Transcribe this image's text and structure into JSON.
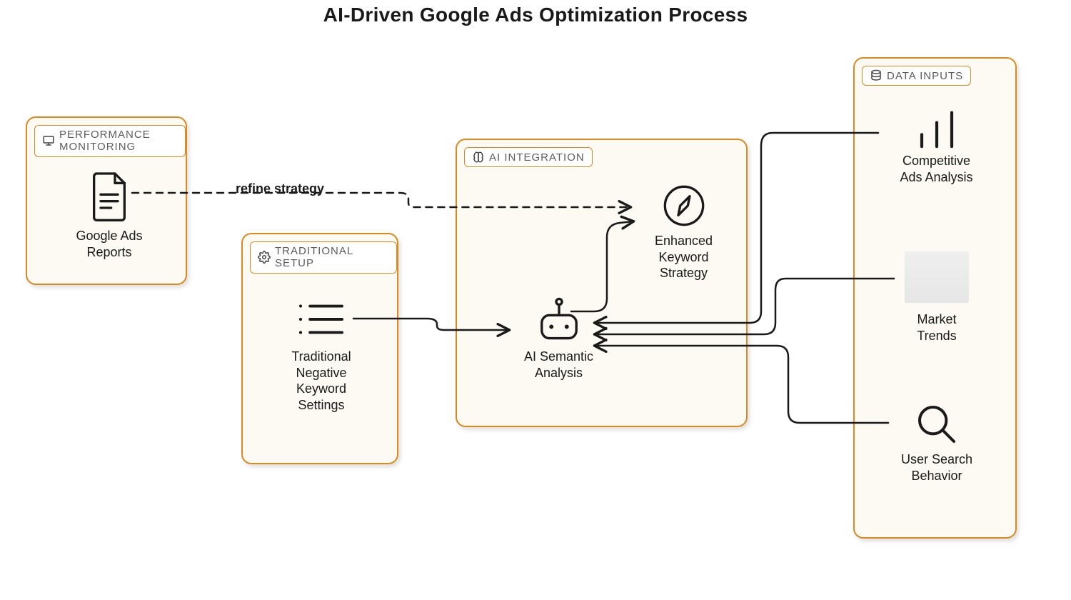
{
  "title": "AI-Driven Google Ads Optimization Process",
  "panels": {
    "performance": {
      "label": "PERFORMANCE MONITORING"
    },
    "traditional": {
      "label": "TRADITIONAL SETUP"
    },
    "ai": {
      "label": "AI INTEGRATION"
    },
    "data": {
      "label": "DATA INPUTS"
    }
  },
  "nodes": {
    "reports": {
      "label": "Google Ads Reports"
    },
    "neg_keywords": {
      "label": "Traditional Negative Keyword Settings"
    },
    "semantic": {
      "label": "AI Semantic Analysis"
    },
    "strategy": {
      "label": "Enhanced Keyword Strategy"
    },
    "competitive": {
      "label": "Competitive Ads Analysis"
    },
    "market": {
      "label": "Market Trends"
    },
    "search": {
      "label": "User Search Behavior"
    }
  },
  "edges": {
    "refine": {
      "label": "refine strategy"
    }
  }
}
